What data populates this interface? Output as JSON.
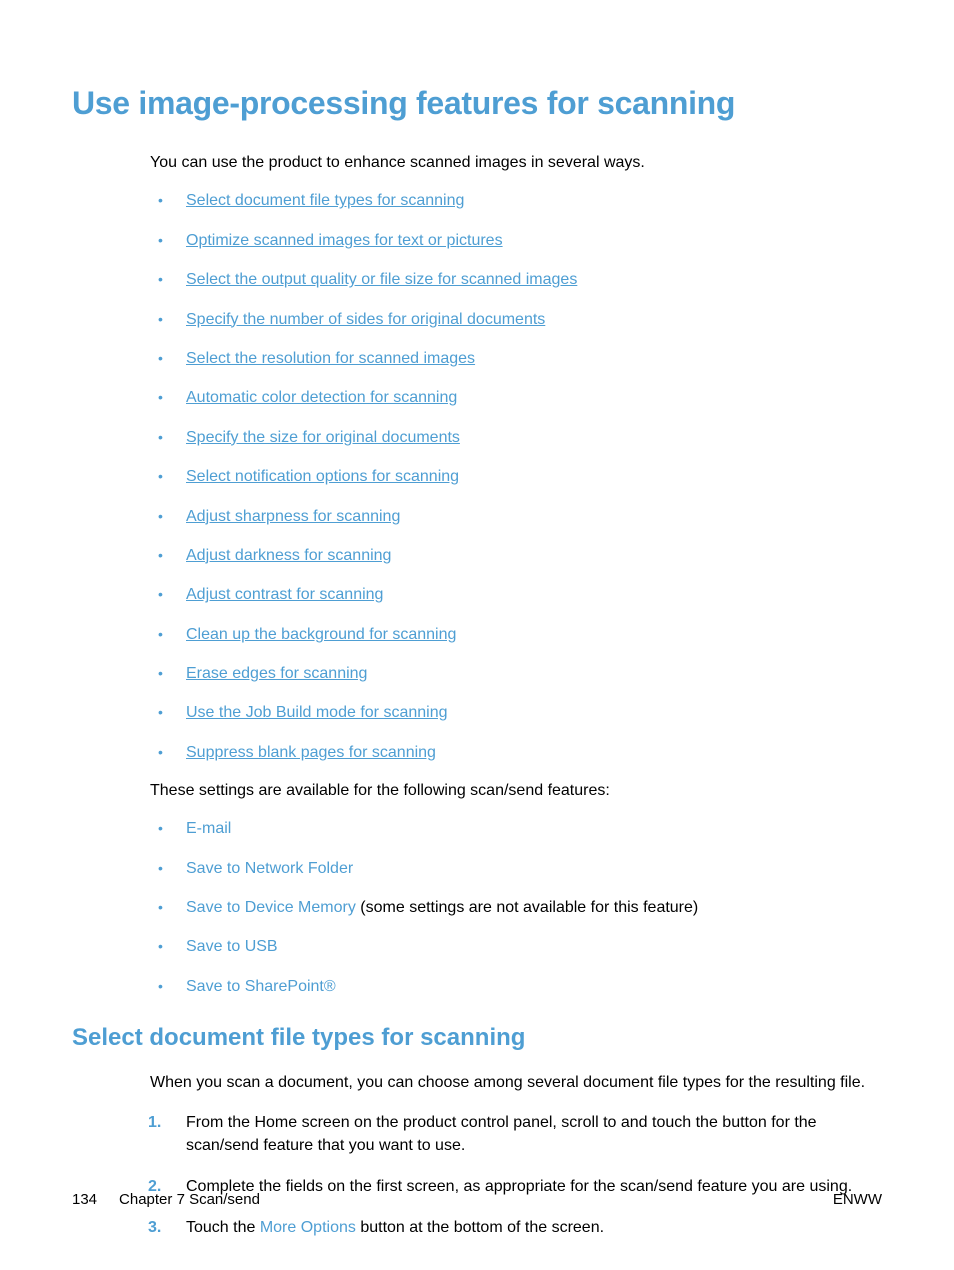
{
  "title": "Use image-processing features for scanning",
  "intro": "You can use the product to enhance scanned images in several ways.",
  "toc_links": [
    "Select document file types for scanning",
    "Optimize scanned images for text or pictures",
    "Select the output quality or file size for scanned images",
    "Specify the number of sides for original documents",
    "Select the resolution for scanned images",
    "Automatic color detection for scanning",
    "Specify the size for original documents",
    "Select notification options for scanning",
    "Adjust sharpness for scanning",
    "Adjust darkness for scanning",
    "Adjust contrast for scanning",
    "Clean up the background for scanning",
    "Erase edges for scanning",
    "Use the Job Build mode for scanning",
    "Suppress blank pages for scanning"
  ],
  "availability_note": "These settings are available for the following scan/send features:",
  "features": [
    {
      "name": "E-mail",
      "extra": ""
    },
    {
      "name": "Save to Network Folder",
      "extra": ""
    },
    {
      "name": "Save to Device Memory",
      "extra": " (some settings are not available for this feature)"
    },
    {
      "name": "Save to USB",
      "extra": ""
    },
    {
      "name": "Save to SharePoint®",
      "extra": ""
    }
  ],
  "section": {
    "title": "Select document file types for scanning",
    "intro": "When you scan a document, you can choose among several document file types for the resulting file.",
    "steps": {
      "s1": "From the Home screen on the product control panel, scroll to and touch the button for the scan/send feature that you want to use.",
      "s2": "Complete the fields on the first screen, as appropriate for the scan/send feature you are using.",
      "s3_pre": "Touch the ",
      "s3_ui": "More Options",
      "s3_post": " button at the bottom of the screen."
    }
  },
  "footer": {
    "page_number": "134",
    "chapter": "Chapter 7   Scan/send",
    "right": "ENWW"
  }
}
